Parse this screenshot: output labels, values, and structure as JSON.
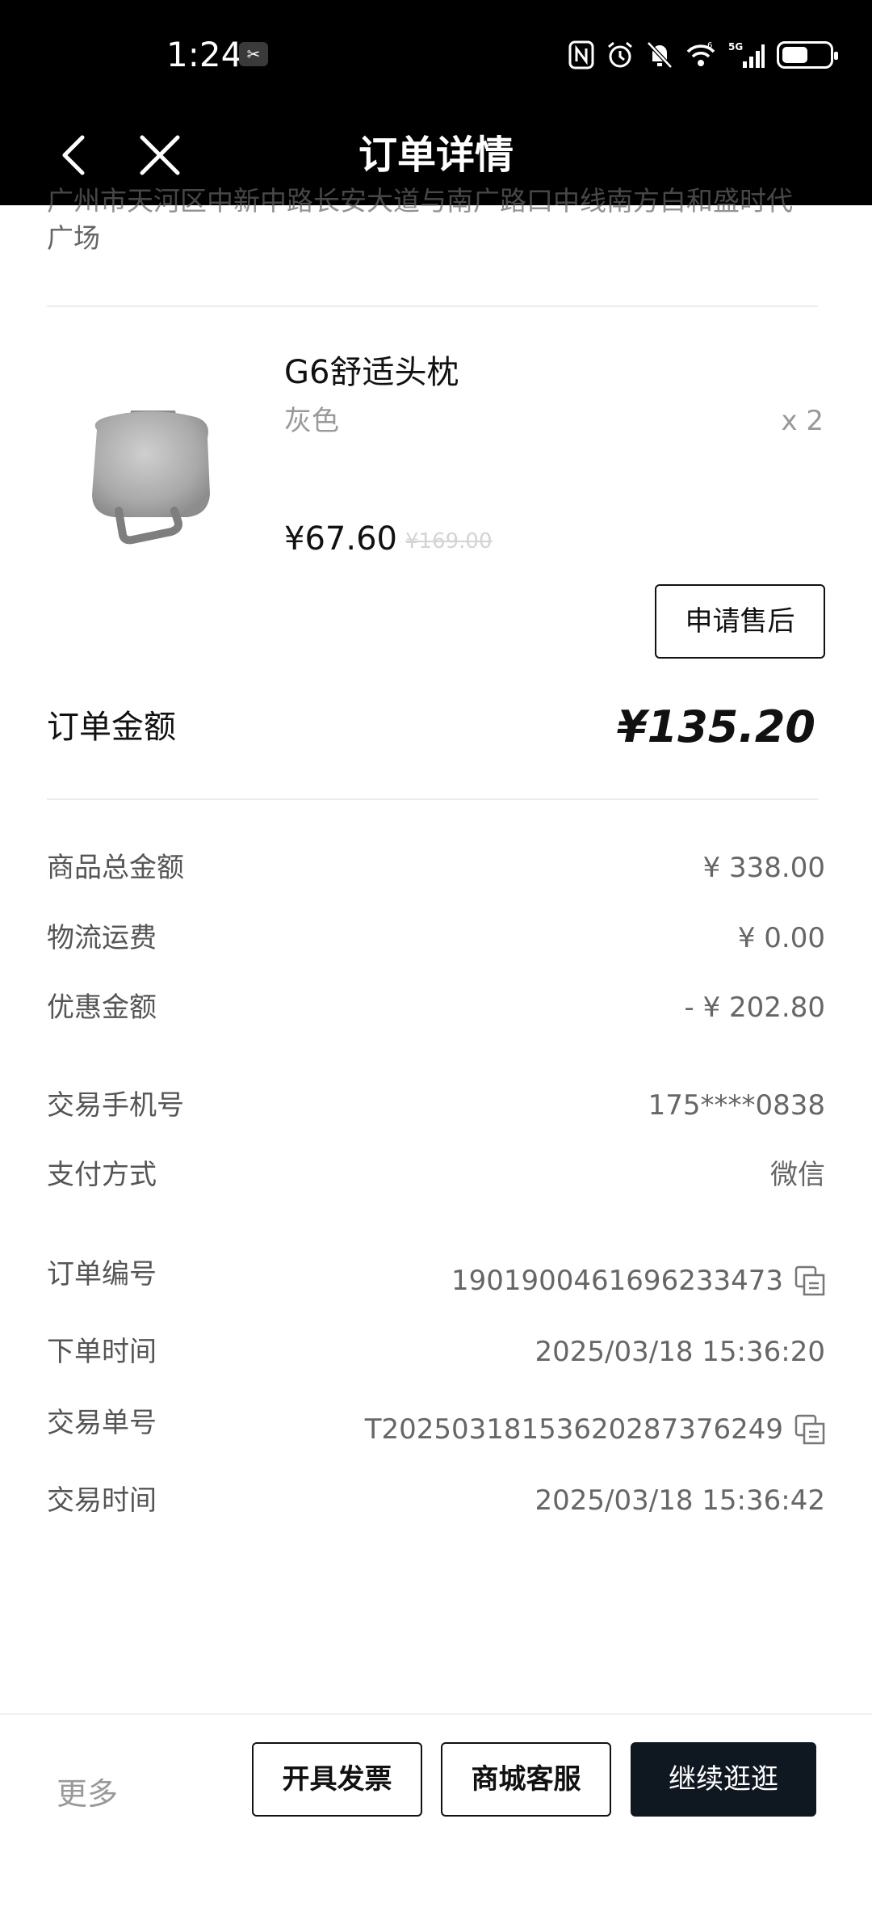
{
  "status_bar": {
    "time": "1:24",
    "time_badge": "✂",
    "icons": [
      "nfc-icon",
      "alarm-icon",
      "mute-icon",
      "wifi-icon",
      "5g-signal-icon",
      "battery-icon"
    ],
    "battery_level_percent": 55
  },
  "nav": {
    "title": "订单详情",
    "back_icon": "chevron-left-icon",
    "close_icon": "close-icon"
  },
  "address": {
    "line1": "广州市天河区中新中路长安大道与南广路口中线南方白和盛时代",
    "line2": "广场"
  },
  "product": {
    "name": "G6舒适头枕",
    "spec": "灰色",
    "qty": "x 2",
    "price": "¥67.60",
    "original_price": "¥169.00",
    "after_sale_label": "申请售后"
  },
  "order_total": {
    "label": "订单金额",
    "value": "¥135.20"
  },
  "summary": [
    {
      "label": "商品总金额",
      "value": "¥ 338.00"
    },
    {
      "label": "物流运费",
      "value": "¥ 0.00"
    },
    {
      "label": "优惠金额",
      "value": "- ¥ 202.80"
    }
  ],
  "payment": [
    {
      "label": "交易手机号",
      "value": "175****0838"
    },
    {
      "label": "支付方式",
      "value": "微信"
    }
  ],
  "order_info": [
    {
      "label": "订单编号",
      "value": "1901900461696233473",
      "copyable": true
    },
    {
      "label": "下单时间",
      "value": "2025/03/18 15:36:20",
      "copyable": false
    },
    {
      "label": "交易单号",
      "value": "T20250318153620287376249",
      "copyable": true
    },
    {
      "label": "交易时间",
      "value": "2025/03/18 15:36:42",
      "copyable": false
    }
  ],
  "bottom_bar": {
    "more_label": "更多",
    "invoice_label": "开具发票",
    "service_label": "商城客服",
    "continue_label": "继续逛逛"
  },
  "colors": {
    "header_bg": "#000000",
    "primary_button": "#0f1720",
    "muted_text": "#999999"
  }
}
